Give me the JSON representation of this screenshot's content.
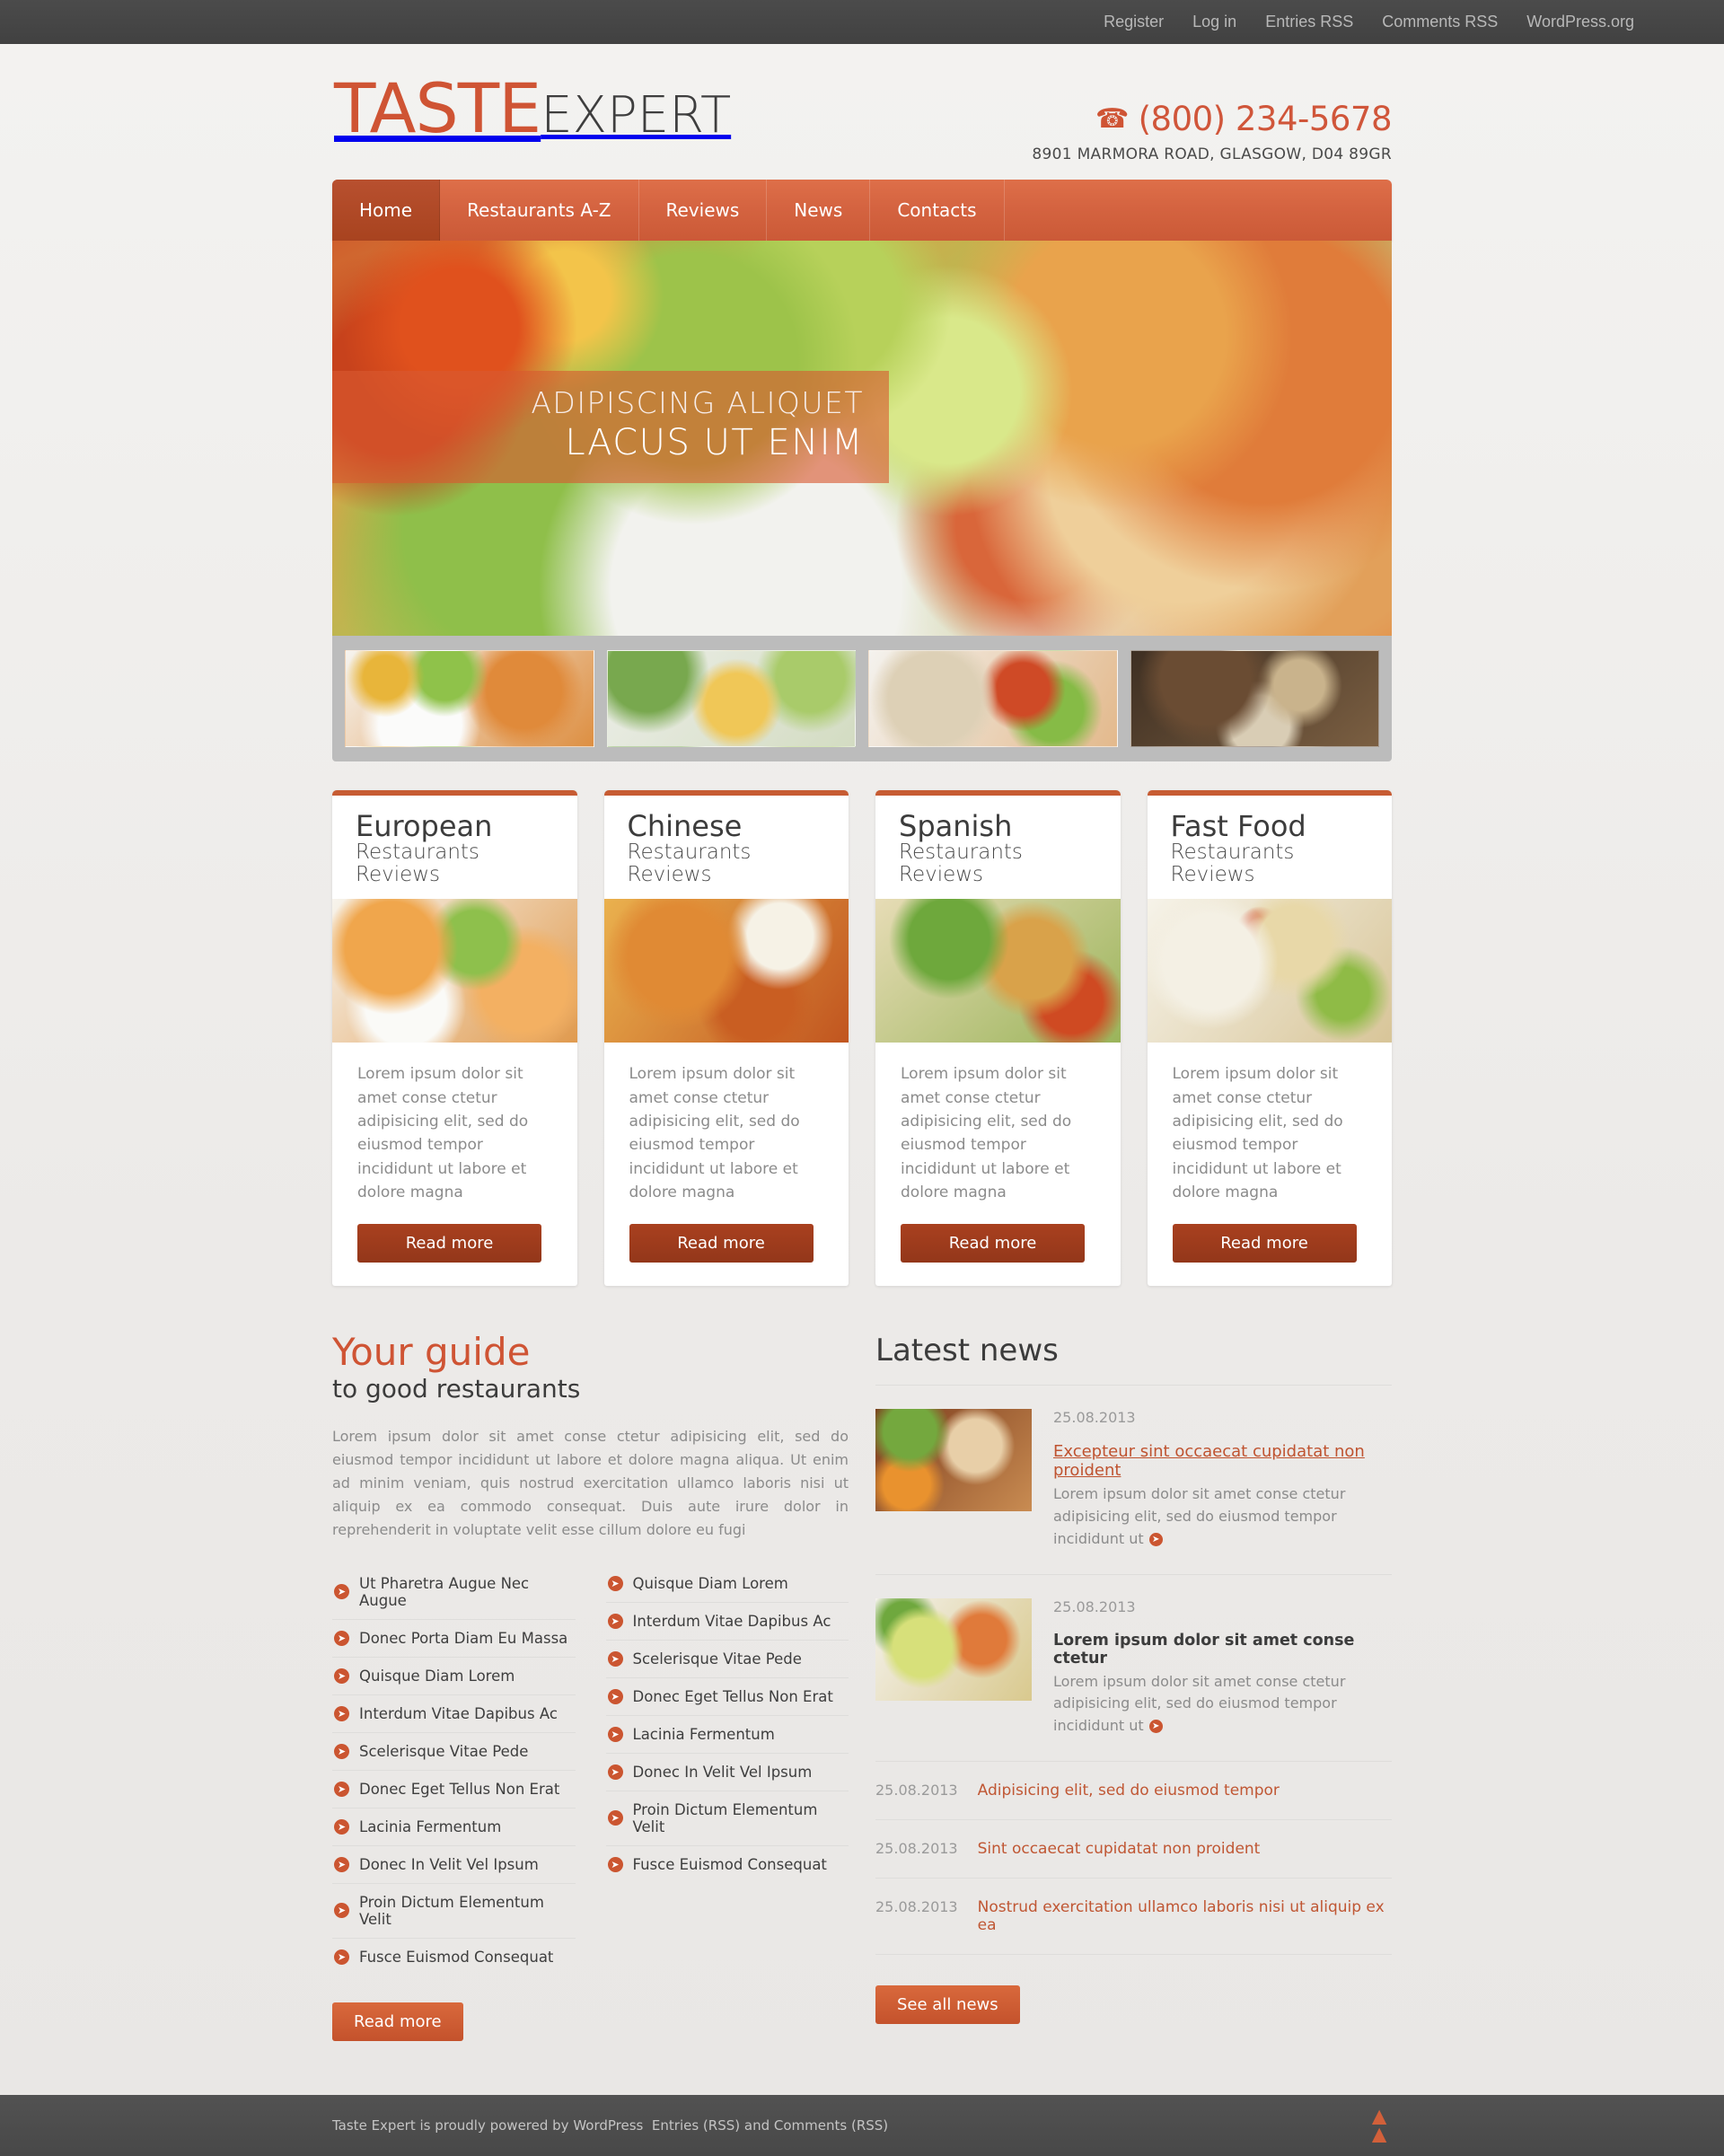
{
  "adminbar": {
    "links": [
      {
        "label": "Register"
      },
      {
        "label": "Log in"
      },
      {
        "label": "Entries RSS"
      },
      {
        "label": "Comments RSS"
      },
      {
        "label": "WordPress.org"
      }
    ]
  },
  "header": {
    "logo_primary": "TASTE",
    "logo_secondary": "EXPERT",
    "phone": "(800) 234-5678",
    "address": "8901 MARMORA ROAD, GLASGOW, D04 89GR",
    "phone_icon": "phone-icon"
  },
  "nav": {
    "items": [
      {
        "label": "Home",
        "active": true
      },
      {
        "label": "Restaurants A-Z",
        "active": false
      },
      {
        "label": "Reviews",
        "active": false
      },
      {
        "label": "News",
        "active": false
      },
      {
        "label": "Contacts",
        "active": false
      }
    ]
  },
  "slider": {
    "caption_line1": "ADIPISCING ALIQUET",
    "caption_line2": "LACUS UT ENIM",
    "thumbs": [
      {
        "alt": "quesadilla-salad-thumbnail"
      },
      {
        "alt": "pasta-mushroom-thumbnail"
      },
      {
        "alt": "wrap-sandwich-thumbnail"
      },
      {
        "alt": "restaurant-table-thumbnail"
      }
    ]
  },
  "cards": [
    {
      "title": "European",
      "subtitle": "Restaurants Reviews",
      "text": "Lorem ipsum dolor sit amet conse ctetur adipisicing elit, sed do eiusmod tempor incididunt ut labore et dolore magna",
      "button": "Read more",
      "image_alt": "european-dish-image"
    },
    {
      "title": "Chinese",
      "subtitle": "Restaurants Reviews",
      "text": "Lorem ipsum dolor sit amet conse ctetur adipisicing elit, sed do eiusmod tempor incididunt ut labore et dolore magna",
      "button": "Read more",
      "image_alt": "chinese-dish-image"
    },
    {
      "title": "Spanish",
      "subtitle": "Restaurants Reviews",
      "text": "Lorem ipsum dolor sit amet conse ctetur adipisicing elit, sed do eiusmod tempor incididunt ut labore et dolore magna",
      "button": "Read more",
      "image_alt": "spanish-dish-image"
    },
    {
      "title": "Fast Food",
      "subtitle": "Restaurants Reviews",
      "text": "Lorem ipsum dolor sit amet conse ctetur adipisicing elit, sed do eiusmod tempor incididunt ut labore et dolore magna",
      "button": "Read more",
      "image_alt": "fast-food-dish-image"
    }
  ],
  "guide": {
    "heading": "Your guide",
    "subheading": "to good restaurants",
    "paragraph": "Lorem ipsum dolor sit amet conse ctetur adipisicing elit, sed do eiusmod tempor incididunt ut labore et dolore magna aliqua. Ut enim ad minim veniam, quis nostrud exercitation ullamco laboris nisi ut aliquip ex ea commodo consequat. Duis aute irure dolor in reprehenderit in voluptate velit esse cillum dolore eu fugi",
    "button": "Read more",
    "list_left": [
      {
        "label": "Ut Pharetra Augue Nec Augue"
      },
      {
        "label": "Donec Porta Diam Eu Massa"
      },
      {
        "label": "Quisque Diam Lorem"
      },
      {
        "label": "Interdum Vitae Dapibus Ac"
      },
      {
        "label": "Scelerisque Vitae Pede"
      },
      {
        "label": "Donec Eget Tellus Non Erat"
      },
      {
        "label": "Lacinia Fermentum"
      },
      {
        "label": "Donec In Velit Vel Ipsum"
      },
      {
        "label": "Proin Dictum Elementum Velit"
      },
      {
        "label": "Fusce Euismod Consequat"
      }
    ],
    "list_right": [
      {
        "label": "Quisque Diam Lorem"
      },
      {
        "label": "Interdum Vitae Dapibus Ac"
      },
      {
        "label": "Scelerisque Vitae Pede"
      },
      {
        "label": "Donec Eget Tellus Non Erat"
      },
      {
        "label": "Lacinia Fermentum"
      },
      {
        "label": "Donec In Velit Vel Ipsum"
      },
      {
        "label": "Proin Dictum Elementum Velit"
      },
      {
        "label": "Fusce Euismod Consequat"
      }
    ]
  },
  "news": {
    "heading": "Latest news",
    "items": [
      {
        "date": "25.08.2013",
        "title": "Excepteur sint occaecat cupidatat non proident",
        "excerpt": "Lorem ipsum dolor sit amet conse ctetur adipisicing elit, sed do eiusmod tempor incididunt ut",
        "image_alt": "news-image-prosciutto-breadsticks",
        "title_style": "link"
      },
      {
        "date": "25.08.2013",
        "title": "Lorem ipsum dolor sit amet conse ctetur",
        "excerpt": "Lorem ipsum dolor sit amet conse ctetur adipisicing elit, sed do eiusmod tempor incididunt ut",
        "image_alt": "news-image-apple-salad",
        "title_style": "plain"
      }
    ],
    "links": [
      {
        "date": "25.08.2013",
        "label": "Adipisicing elit, sed do eiusmod tempor"
      },
      {
        "date": "25.08.2013",
        "label": "Sint occaecat cupidatat non proident"
      },
      {
        "date": "25.08.2013",
        "label": "Nostrud exercitation ullamco laboris nisi ut aliquip ex ea"
      }
    ],
    "button": "See all news"
  },
  "footer": {
    "text": "Taste Expert is proudly powered by WordPress",
    "entries": "Entries (RSS)",
    "and": "and",
    "comments": "Comments (RSS)",
    "totop_icon": "chevron-double-up-icon"
  },
  "colors": {
    "accent": "#cf5434",
    "accent_dark": "#a9401f",
    "nav": "#d4633f",
    "text_dark": "#3c3c3c",
    "text_muted": "#8b8b8b",
    "bar_dark": "#464646"
  }
}
